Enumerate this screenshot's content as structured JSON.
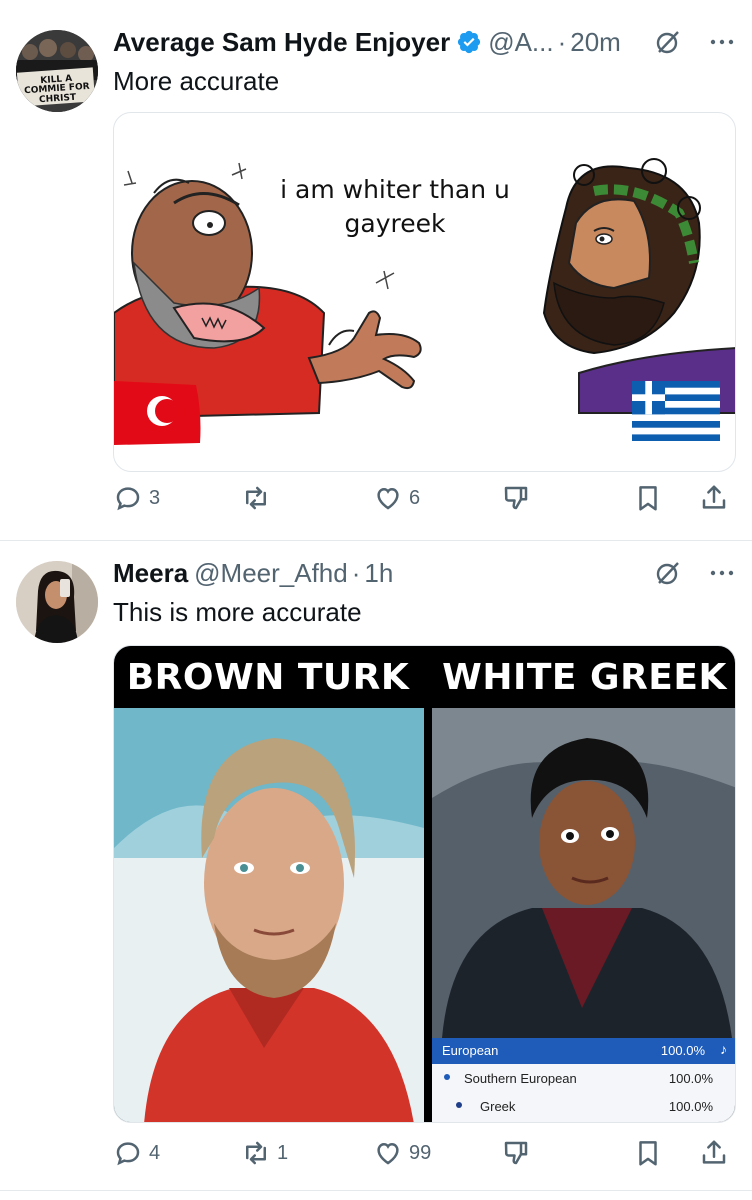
{
  "tweets": [
    {
      "display_name": "Average Sam Hyde Enjoyer",
      "handle": "@A...",
      "time": "20m",
      "text": "More accurate",
      "avatar_sign": "KILL A COMMIE FOR CHRIST",
      "media": {
        "caption_line1": "i am whiter than u",
        "caption_line2": "gayreek"
      },
      "stats": {
        "replies": "3",
        "retweets": "",
        "likes": "6"
      }
    },
    {
      "display_name": "Meera",
      "handle": "@Meer_Afhd",
      "time": "1h",
      "text": "This is more accurate",
      "media": {
        "left_label": "BROWN TURK",
        "right_label": "WHITE GREEK",
        "ancestry": {
          "header_label": "European",
          "header_value": "100.0%",
          "rows": [
            {
              "label": "Southern European",
              "value": "100.0%"
            },
            {
              "label": "Greek",
              "value": "100.0%"
            }
          ]
        }
      },
      "stats": {
        "replies": "4",
        "retweets": "1",
        "likes": "99"
      }
    }
  ],
  "icons": {
    "verified": "verified-badge-icon",
    "grok": "grok-icon",
    "more": "more-icon",
    "reply": "reply-icon",
    "retweet": "retweet-icon",
    "like": "like-icon",
    "dislike": "dislike-icon",
    "bookmark": "bookmark-icon",
    "share": "share-icon"
  },
  "colors": {
    "text": "#0f1419",
    "secondary": "#536471",
    "verified": "#1d9bf0",
    "divider": "#e6e9ec"
  }
}
